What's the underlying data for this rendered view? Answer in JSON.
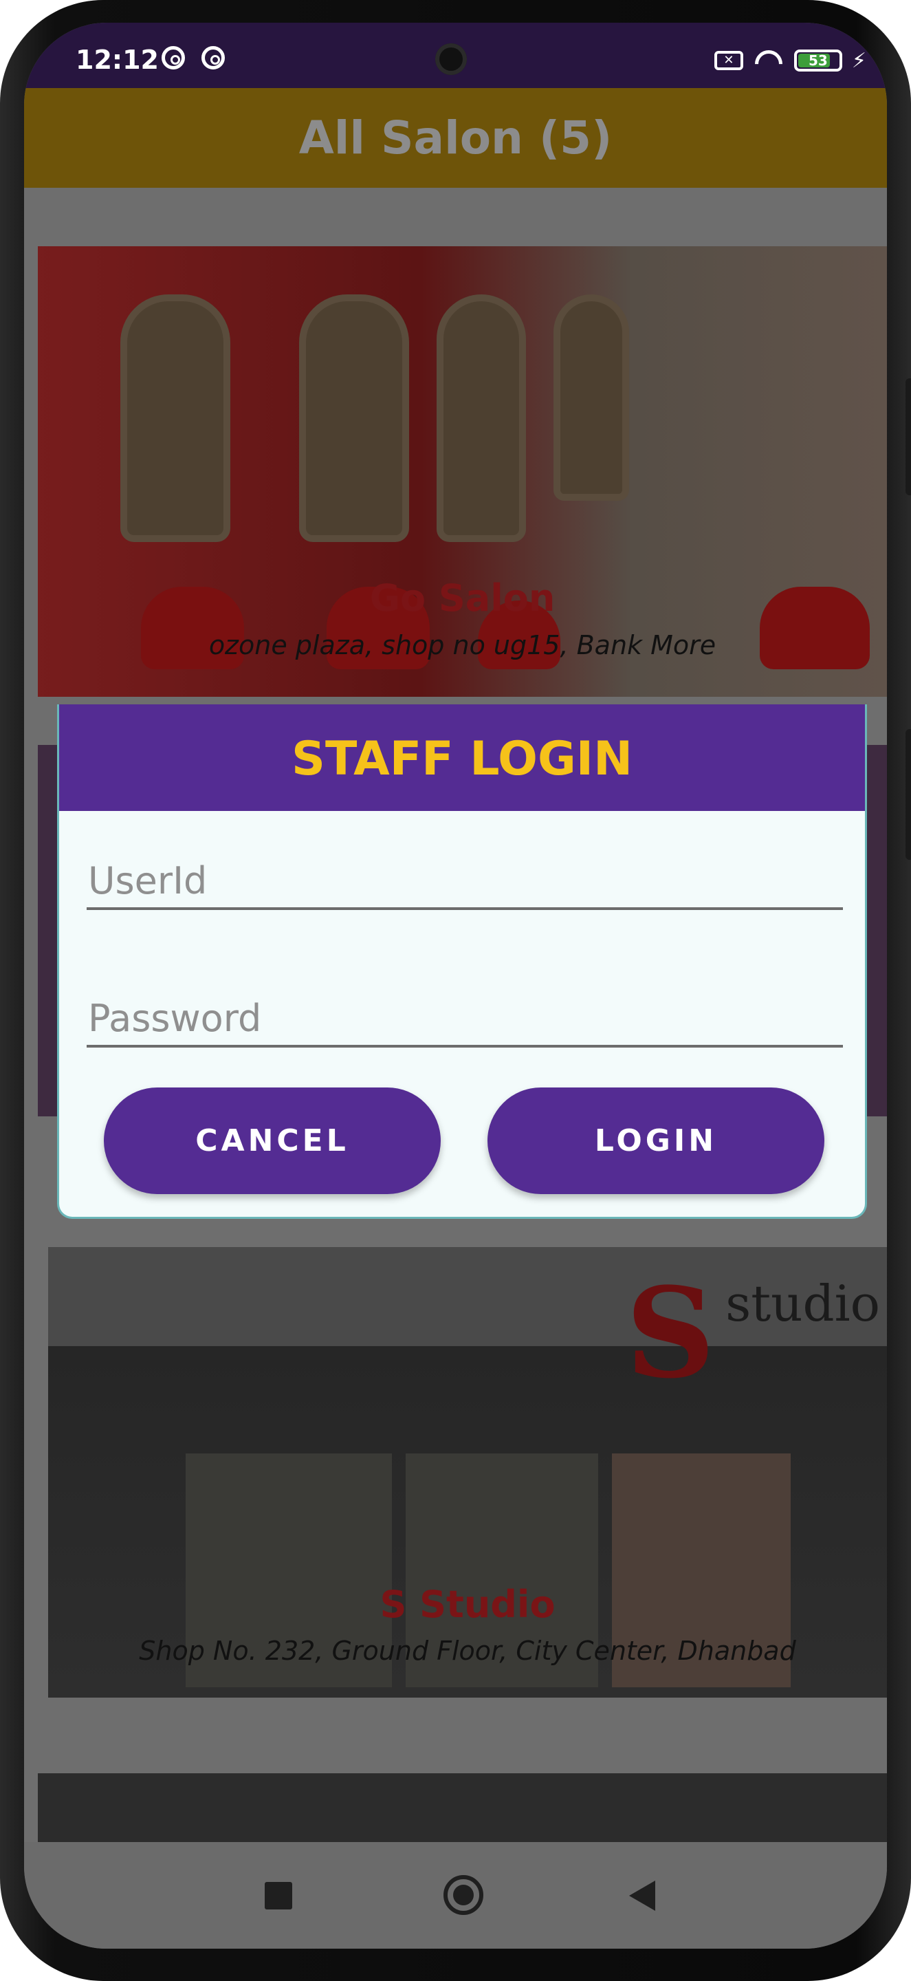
{
  "status_bar": {
    "time": "12:12",
    "battery_level": "53",
    "icons": [
      "app-notification-icon",
      "app-notification-icon",
      "no-sim-icon",
      "wifi-icon",
      "battery-icon",
      "charging-icon"
    ]
  },
  "app_bar": {
    "title": "All Salon (5)"
  },
  "salons": [
    {
      "name": "Go Salon",
      "address": "ozone plaza, shop no ug15, Bank More"
    },
    {
      "name": "S Studio",
      "address": "Shop No. 232, Ground Floor, City Center, Dhanbad"
    }
  ],
  "dialog": {
    "title": "STAFF LOGIN",
    "userid_placeholder": "UserId",
    "userid_value": "",
    "password_placeholder": "Password",
    "password_value": "",
    "cancel_label": "CANCEL",
    "login_label": "LOGIN"
  },
  "nav_bar": {
    "buttons": [
      "recents-icon",
      "home-icon",
      "back-icon"
    ]
  },
  "colors": {
    "dialog_header": "#542c93",
    "dialog_title": "#f6c21a",
    "button": "#542c93",
    "app_bar": "#6e5409"
  }
}
